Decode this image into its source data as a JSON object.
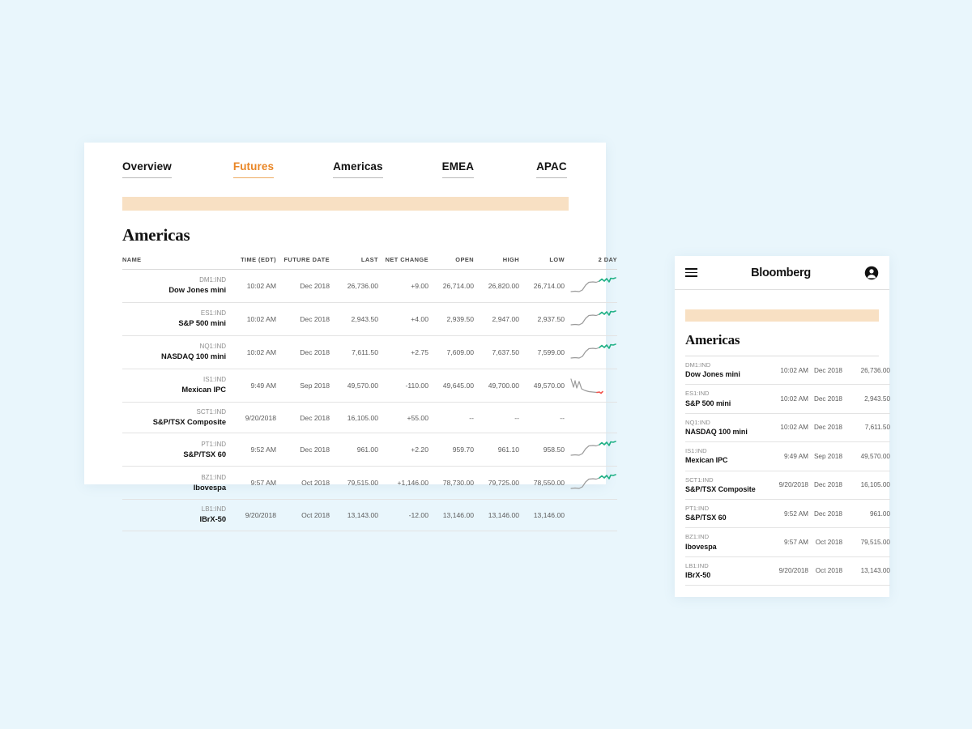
{
  "theme": {
    "page_background": "#e9f6fc",
    "card_background": "#ffffff",
    "accent_orange": "#e98626",
    "band_color": "#f8e0c3",
    "positive_color": "#21b186",
    "negative_color": "#f2544e"
  },
  "desktop": {
    "tabs": [
      {
        "label": "Overview",
        "active": false
      },
      {
        "label": "Futures",
        "active": true
      },
      {
        "label": "Americas",
        "active": false
      },
      {
        "label": "EMEA",
        "active": false
      },
      {
        "label": "APAC",
        "active": false
      }
    ],
    "section_title": "Americas",
    "columns": [
      "NAME",
      "TIME (EDT)",
      "FUTURE DATE",
      "LAST",
      "NET CHANGE",
      "OPEN",
      "HIGH",
      "LOW",
      "2 DAY"
    ],
    "rows": [
      {
        "ticker": "DM1:IND",
        "name": "Dow Jones mini",
        "time": "10:02 AM",
        "future_date": "Dec 2018",
        "last": "26,736.00",
        "net_change": "+9.00",
        "direction": "up",
        "open": "26,714.00",
        "high": "26,820.00",
        "low": "26,714.00",
        "spark_icon": "sparkline-up"
      },
      {
        "ticker": "ES1:IND",
        "name": "S&P 500 mini",
        "time": "10:02 AM",
        "future_date": "Dec 2018",
        "last": "2,943.50",
        "net_change": "+4.00",
        "direction": "up",
        "open": "2,939.50",
        "high": "2,947.00",
        "low": "2,937.50",
        "spark_icon": "sparkline-up"
      },
      {
        "ticker": "NQ1:IND",
        "name": "NASDAQ 100 mini",
        "time": "10:02 AM",
        "future_date": "Dec 2018",
        "last": "7,611.50",
        "net_change": "+2.75",
        "direction": "up",
        "open": "7,609.00",
        "high": "7,637.50",
        "low": "7,599.00",
        "spark_icon": "sparkline-up"
      },
      {
        "ticker": "IS1:IND",
        "name": "Mexican IPC",
        "time": "9:49 AM",
        "future_date": "Sep 2018",
        "last": "49,570.00",
        "net_change": "-110.00",
        "direction": "down",
        "open": "49,645.00",
        "high": "49,700.00",
        "low": "49,570.00",
        "spark_icon": "sparkline-down"
      },
      {
        "ticker": "SCT1:IND",
        "name": "S&P/TSX Composite",
        "time": "9/20/2018",
        "future_date": "Dec 2018",
        "last": "16,105.00",
        "net_change": "+55.00",
        "direction": "up",
        "open": "--",
        "high": "--",
        "low": "--",
        "spark_icon": "none"
      },
      {
        "ticker": "PT1:IND",
        "name": "S&P/TSX 60",
        "time": "9:52 AM",
        "future_date": "Dec 2018",
        "last": "961.00",
        "net_change": "+2.20",
        "direction": "up",
        "open": "959.70",
        "high": "961.10",
        "low": "958.50",
        "spark_icon": "sparkline-up"
      },
      {
        "ticker": "BZ1:IND",
        "name": "Ibovespa",
        "time": "9:57 AM",
        "future_date": "Oct 2018",
        "last": "79,515.00",
        "net_change": "+1,146.00",
        "direction": "up",
        "open": "78,730.00",
        "high": "79,725.00",
        "low": "78,550.00",
        "spark_icon": "sparkline-up"
      },
      {
        "ticker": "LB1:IND",
        "name": "IBrX-50",
        "time": "9/20/2018",
        "future_date": "Oct 2018",
        "last": "13,143.00",
        "net_change": "-12.00",
        "direction": "down",
        "open": "13,146.00",
        "high": "13,146.00",
        "low": "13,146.00",
        "spark_icon": "none"
      }
    ]
  },
  "mobile": {
    "menu_icon": "hamburger-icon",
    "brand": "Bloomberg",
    "account_icon": "account-avatar-icon",
    "section_title": "Americas",
    "rows": [
      {
        "ticker": "DM1:IND",
        "name": "Dow Jones mini",
        "time": "10:02 AM",
        "future_date": "Dec 2018",
        "last": "26,736.00"
      },
      {
        "ticker": "ES1:IND",
        "name": "S&P 500 mini",
        "time": "10:02 AM",
        "future_date": "Dec 2018",
        "last": "2,943.50"
      },
      {
        "ticker": "NQ1:IND",
        "name": "NASDAQ 100 mini",
        "time": "10:02 AM",
        "future_date": "Dec 2018",
        "last": "7,611.50"
      },
      {
        "ticker": "IS1:IND",
        "name": "Mexican IPC",
        "time": "9:49 AM",
        "future_date": "Sep 2018",
        "last": "49,570.00"
      },
      {
        "ticker": "SCT1:IND",
        "name": "S&P/TSX Composite",
        "time": "9/20/2018",
        "future_date": "Dec 2018",
        "last": "16,105.00"
      },
      {
        "ticker": "PT1:IND",
        "name": "S&P/TSX 60",
        "time": "9:52 AM",
        "future_date": "Dec 2018",
        "last": "961.00"
      },
      {
        "ticker": "BZ1:IND",
        "name": "Ibovespa",
        "time": "9:57 AM",
        "future_date": "Oct 2018",
        "last": "79,515.00"
      },
      {
        "ticker": "LB1:IND",
        "name": "IBrX-50",
        "time": "9/20/2018",
        "future_date": "Oct 2018",
        "last": "13,143.00"
      }
    ]
  }
}
